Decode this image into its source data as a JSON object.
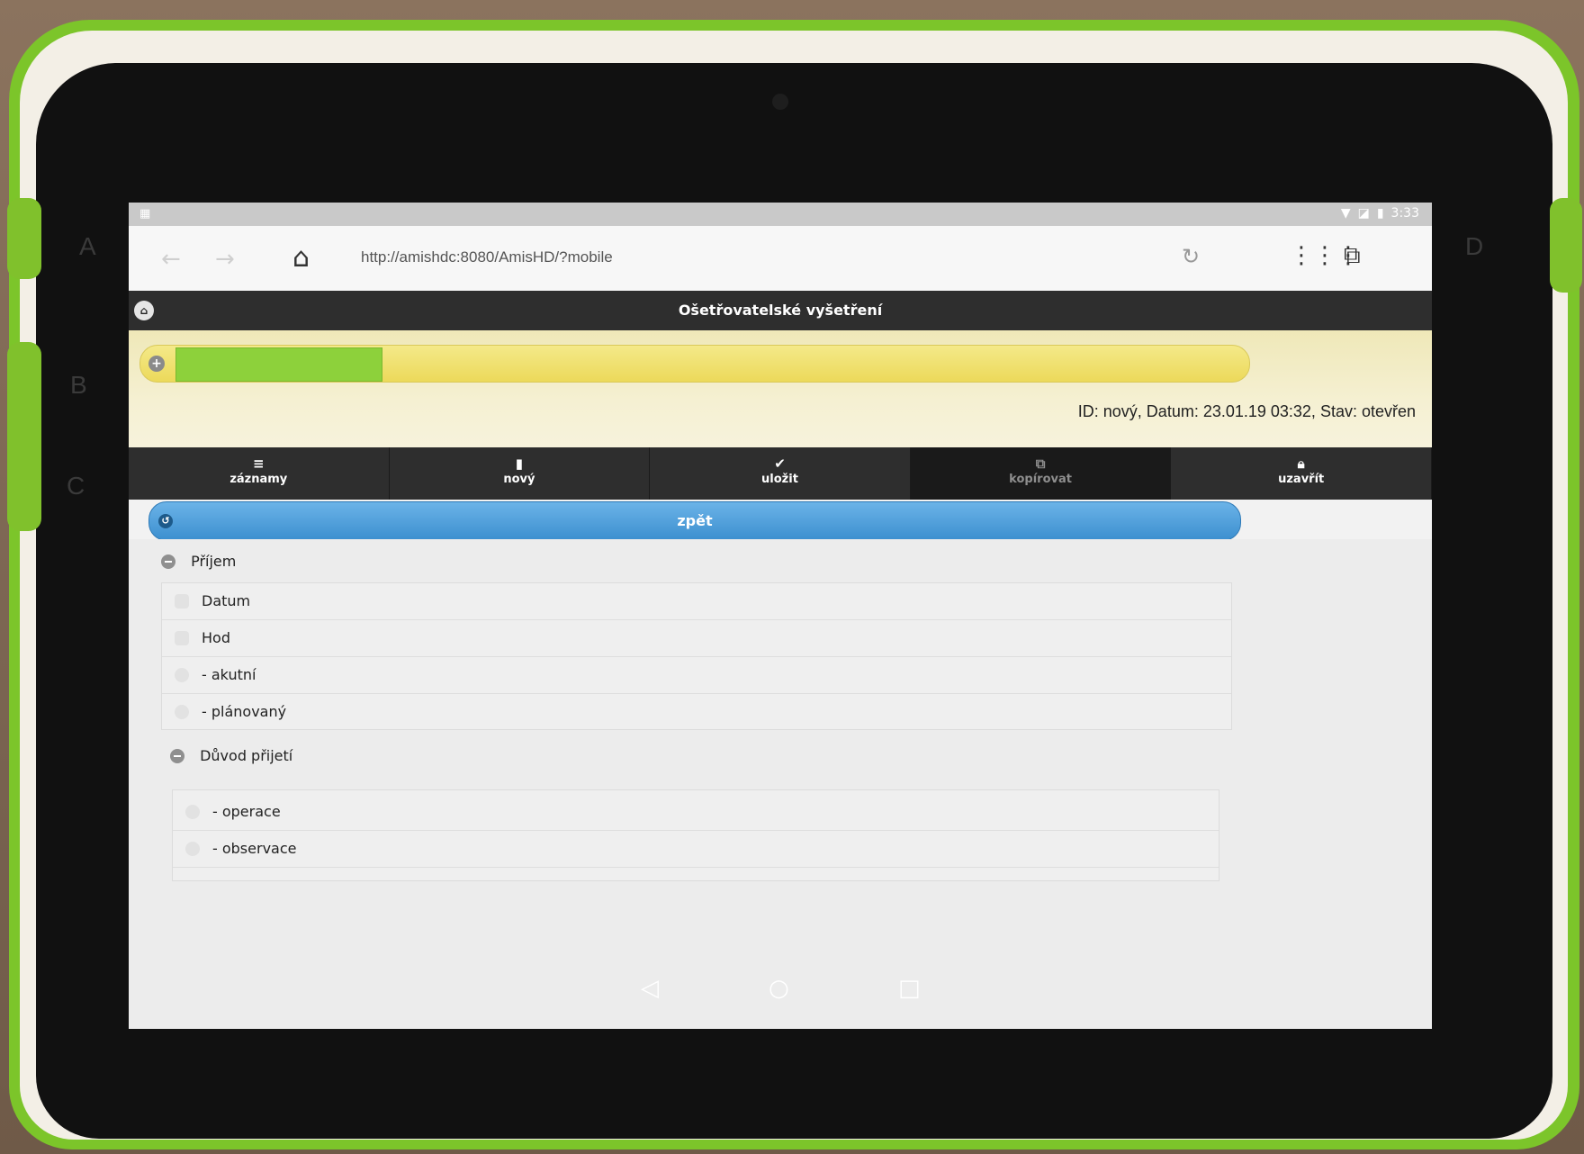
{
  "frame": {
    "side_letters": [
      "A",
      "B",
      "C",
      "D"
    ]
  },
  "status_bar": {
    "time": "3:33"
  },
  "browser": {
    "url": "http://amishdc:8080/AmisHD/?mobile"
  },
  "page": {
    "title": "Ošetřovatelské vyšetření",
    "record_info": "ID: nový, Datum: 23.01.19 03:32, Stav: otevřen"
  },
  "toolbar": {
    "items": [
      {
        "label": "záznamy",
        "icon": "list-icon"
      },
      {
        "label": "nový",
        "icon": "document-icon"
      },
      {
        "label": "uložit",
        "icon": "check-icon"
      },
      {
        "label": "kopírovat",
        "icon": "copy-icon"
      },
      {
        "label": "uzavřít",
        "icon": "lock-icon"
      }
    ]
  },
  "back_button": {
    "label": "zpět"
  },
  "sections": [
    {
      "title": "Příjem",
      "rows": [
        "Datum",
        "Hod",
        "- akutní",
        "- plánovaný"
      ]
    },
    {
      "title": "Důvod přijetí",
      "rows": [
        "- operace",
        "- observace"
      ]
    }
  ],
  "colors": {
    "accent_blue": "#3c8fcf",
    "header_dark": "#2e2e2e",
    "patient_band_yellow": "#ecd95a",
    "redaction_green": "#8dd13b",
    "tablet_green": "#7cc52a"
  }
}
